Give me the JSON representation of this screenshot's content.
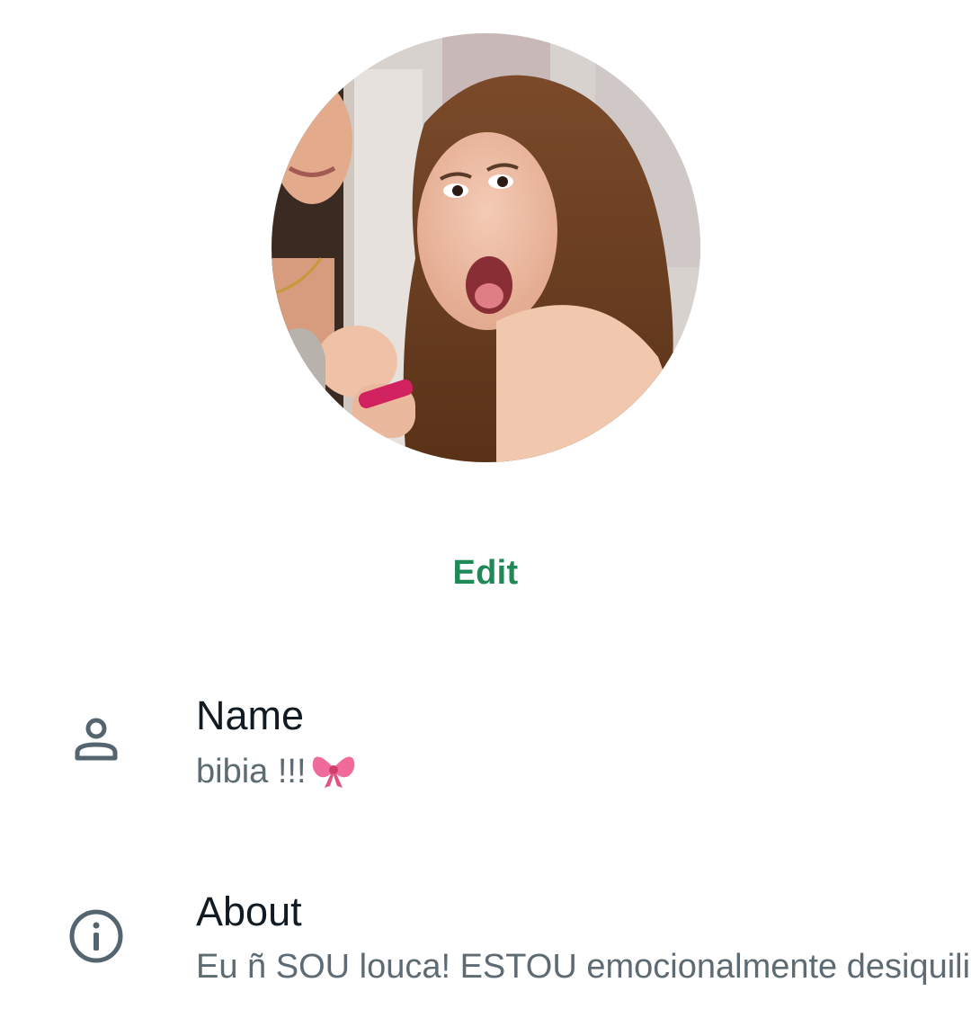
{
  "profile": {
    "edit_label": "Edit"
  },
  "fields": {
    "name": {
      "label": "Name",
      "value": "bibia !!!",
      "icon": "person-icon"
    },
    "about": {
      "label": "About",
      "value": "Eu ñ SOU louca! ESTOU emocionalmente desiquilibrada",
      "icon": "info-icon"
    }
  },
  "colors": {
    "accent": "#1f8a56",
    "label": "#111b21",
    "secondary": "#5e6b73",
    "icon": "#54656f"
  }
}
